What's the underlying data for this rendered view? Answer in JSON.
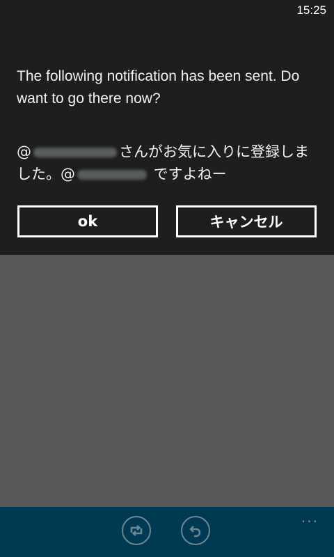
{
  "status_bar": {
    "time": "15:25"
  },
  "dialog": {
    "message": "The following notification has been sent. Do want to go there now?",
    "body_part1": "@",
    "body_part2": "さんがお気に入りに登録しました。@",
    "body_part3": " ですよねー",
    "ok_label": "ok",
    "cancel_label": "キャンセル"
  },
  "appbar": {
    "icons": [
      "retweet-icon",
      "reply-icon"
    ],
    "more_label": "..."
  },
  "colors": {
    "dialog_bg": "#1c1f1c",
    "overlay_bg": "#575757",
    "appbar_bg": "#003a52"
  }
}
